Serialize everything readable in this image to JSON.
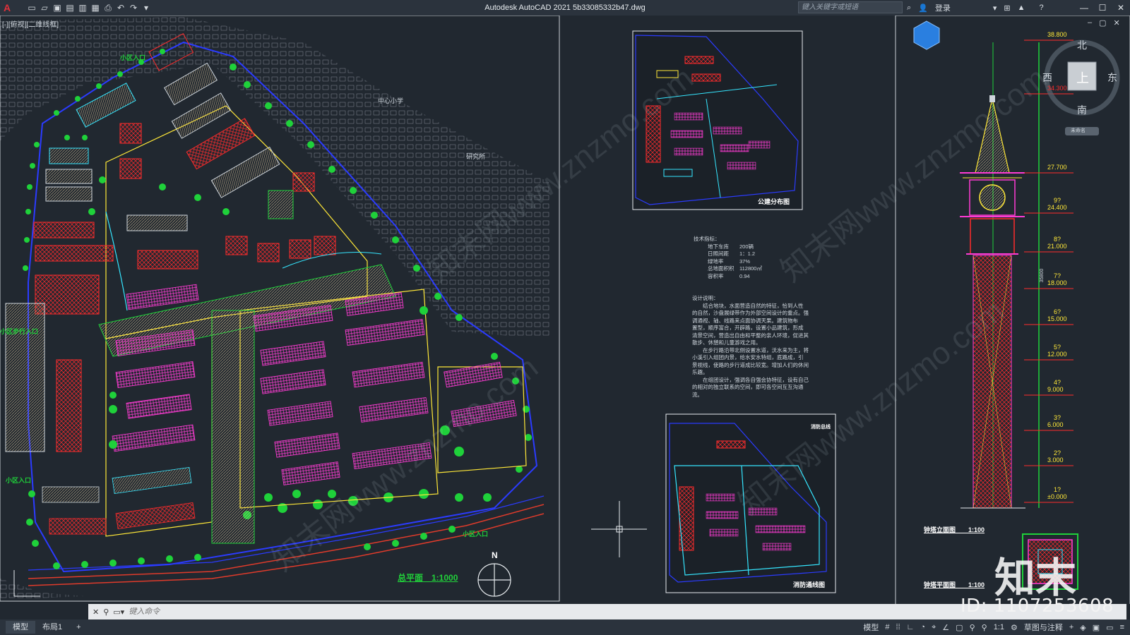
{
  "window": {
    "title": "Autodesk AutoCAD 2021    5b33085332b47.dwg",
    "search_placeholder": "键入关键字或短语",
    "login_label": "登录",
    "quick_access_icons": [
      "new-icon",
      "open-icon",
      "save-icon",
      "saveas-icon",
      "plot-icon",
      "publish-icon",
      "print-icon",
      "undo-icon",
      "redo-icon",
      "dropdown-icon"
    ],
    "controls": [
      "minimize-icon",
      "restore-icon",
      "close-icon"
    ]
  },
  "viewport": {
    "label": "[-][俯视][二维线框]"
  },
  "site_plan": {
    "title": "总平面　1:1000",
    "north_label": "N",
    "labels": [
      "小区入口",
      "中心小学",
      "研究所",
      "小区步行入口",
      "小区入口",
      "小区入口",
      "小区入口"
    ],
    "colors": {
      "tree": "#1fd13a",
      "building": "#ff3bd4",
      "road": "#ffe838",
      "boundary": "#2b3bff",
      "square": "#ff2b2b",
      "water": "#35e6ff"
    }
  },
  "inset_public": {
    "title": "公建分布图"
  },
  "inset_fire": {
    "title": "消防通线图",
    "subtitle": "消防总线"
  },
  "notes": {
    "technical_heading": "技术指标：",
    "technical_lines": [
      "地下车库　　200辆",
      "日照间距　　1：1.2",
      "绿地率　　　37%",
      "总地面积积　112800㎡",
      "容积率　　　0.94"
    ],
    "design_heading": "设计说明：",
    "design_lines": [
      "　　结合地块，水面营造自然的特征，恰到人性",
      "的自然，沙盘展绿带作为外部空间设计的重点。强",
      "调通视、轴、线路来点面协调天果。建筑物布",
      "置型，顺序富合，开辟路，设置小品建筑，形成",
      "清景空间，营造出自由和平整的亲人环境，促进其",
      "散步、休憩和儿童游戏之用。",
      "　　在步行路沿带北侧设置水道，沃水来为主，将",
      "小溪引入组团内景，给水安水特组，底路成，引",
      "景视线，使路的步行道成比较宽。增加人们的休闲",
      "乐趣。",
      "　　在组团设计，强调各自强会协特征，设有自己",
      "的相对的独立联系的空间，即可各空间互互沟通",
      "流。"
    ]
  },
  "tower": {
    "elevation_title": "钟塔立面图　　1:100",
    "plan_title": "钟塔平面图　　1:100",
    "dimension": "35800",
    "levels": [
      {
        "num": "",
        "value": "38.800"
      },
      {
        "num": "",
        "value": "34.300"
      },
      {
        "num": "",
        "value": "27.700"
      },
      {
        "num": "9?",
        "value": "24.400"
      },
      {
        "num": "8?",
        "value": "21.000"
      },
      {
        "num": "7?",
        "value": "18.000"
      },
      {
        "num": "6?",
        "value": "15.000"
      },
      {
        "num": "5?",
        "value": "12.000"
      },
      {
        "num": "4?",
        "value": "9.000"
      },
      {
        "num": "3?",
        "value": "6.000"
      },
      {
        "num": "2?",
        "value": "3.000"
      },
      {
        "num": "1?",
        "value": "±0.000"
      }
    ]
  },
  "viewcube": {
    "north": "北",
    "south": "南",
    "east": "东",
    "west": "西",
    "top": "上",
    "wcs": "未命名"
  },
  "overlay": {
    "brand": "知末",
    "id": "ID: 1107253608",
    "watermark": "知末网www.znzmo.com"
  },
  "command": {
    "placeholder": "键入命令"
  },
  "status": {
    "tabs": [
      "模型",
      "布局1"
    ],
    "add_tab": "+",
    "model_label": "模型",
    "scale": "1:1",
    "workspace": "草图与注释"
  }
}
